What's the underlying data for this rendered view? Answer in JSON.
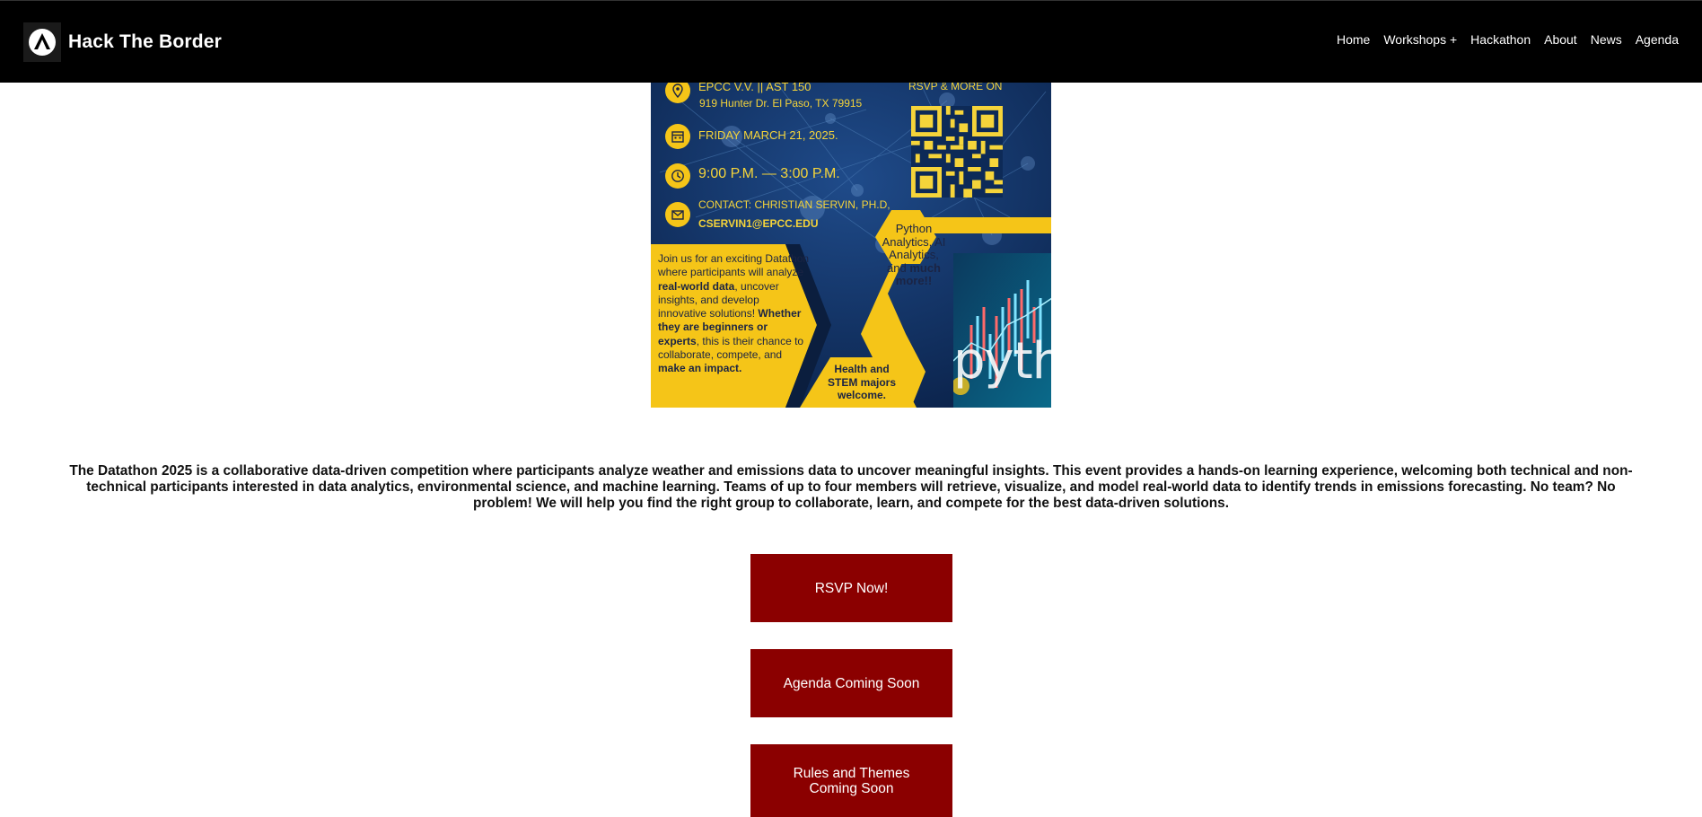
{
  "header": {
    "brand": "Hack The Border",
    "nav": [
      "Home",
      "Workshops +",
      "Hackathon",
      "About",
      "News",
      "Agenda"
    ]
  },
  "flyer": {
    "location_line1": "EPCC V.V. ||  AST 150",
    "location_line2": "919 Hunter Dr. El Paso, TX 79915",
    "date": "FRIDAY MARCH 21, 2025.",
    "time": "9:00 P.M. — 3:00 P.M.",
    "contact_line1": "CONTACT: CHRISTIAN SERVIN, PH.D,",
    "contact_line2": "CSERVIN1@EPCC.EDU",
    "rsvp_more": "RSVP & MORE ON",
    "body_parts": [
      "Join us for an exciting Datathon where participants will analyze ",
      "real-world data",
      ", uncover insights, and develop innovative solutions! ",
      "Whether they are beginners or experts",
      ", this is their chance to collaborate, compete, and ",
      "make an impact."
    ],
    "hex1_parts": [
      "Python Analytics, AI Analytics, and ",
      "much more!!"
    ],
    "hex2": "Health and STEM majors welcome.",
    "python_word": "pytho"
  },
  "description": "The Datathon 2025 is a collaborative data-driven competition where participants analyze weather and emissions data to uncover meaningful insights. This event provides a hands-on learning experience, welcoming both technical and non-technical participants interested in data analytics, environmental science, and machine learning. Teams of up to four members will retrieve, visualize, and model real-world data to identify trends in emissions forecasting. No team? No problem! We will help you find the right group to collaborate, learn, and compete for the best data-driven solutions.",
  "buttons": {
    "rsvp": "RSVP Now!",
    "agenda": "Agenda Coming Soon",
    "rules_line1": "Rules and Themes",
    "rules_line2": "Coming Soon"
  },
  "colors": {
    "navbar_bg": "#000000",
    "button_bg": "#8b0000",
    "flyer_blue": "#0d2a57",
    "flyer_yellow": "#f5c518"
  }
}
